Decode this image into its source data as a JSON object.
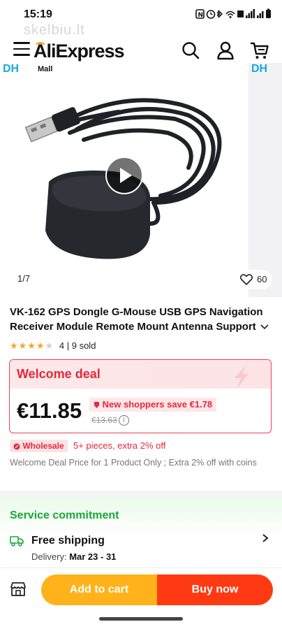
{
  "status_bar": {
    "time": "15:19",
    "icons": "N ⏰ ✱ ᯤ 𝗩𝗼 ▮▮ ▮▮ ▮"
  },
  "watermark": "skelbiu.lt",
  "header": {
    "logo": "AliExpress",
    "icons": [
      "menu-icon",
      "search-icon",
      "account-icon",
      "cart-icon"
    ]
  },
  "gallery": {
    "counter": "1/7",
    "wishlist_count": "60",
    "mall_tag": "Mall",
    "brand_text": "DH",
    "brand_text_next": "DH"
  },
  "product": {
    "title": "VK-162 GPS Dongle G-Mouse USB GPS Navigation Receiver Module Remote Mount Antenna Support",
    "rating_stars": 4,
    "sold": "4 | 9 sold"
  },
  "welcome_deal": {
    "label": "Welcome deal",
    "price": "€11.85",
    "save_text": "New shoppers save €1.78",
    "old_price": "€13.63"
  },
  "wholesale": {
    "badge": "Wholesale",
    "text": "5+ pieces, extra 2% off"
  },
  "deal_note": "Welcome Deal Price for 1 Product Only ; Extra 2% off with coins",
  "service": {
    "title": "Service commitment",
    "shipping_title": "Free shipping",
    "delivery_label": "Delivery:",
    "delivery_dates": "Mar 23 - 31"
  },
  "actions": {
    "add_to_cart": "Add to cart",
    "buy_now": "Buy now"
  },
  "colors": {
    "accent_red": "#e6283c",
    "cart_orange": "#ffb21a",
    "buy_red": "#ff3a12",
    "service_green": "#18a838"
  }
}
